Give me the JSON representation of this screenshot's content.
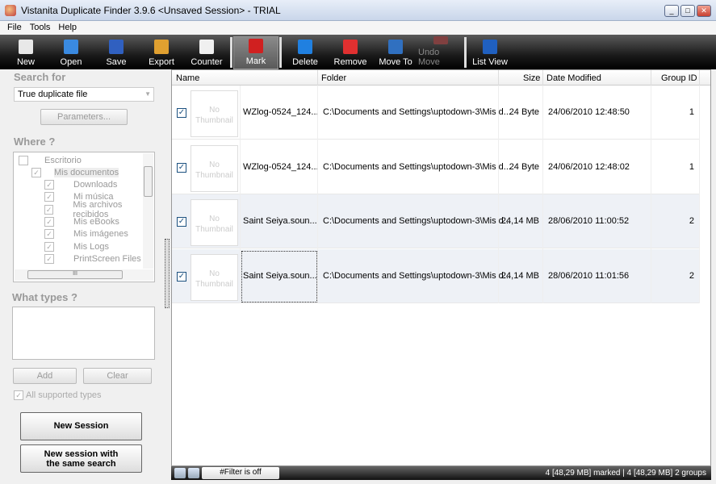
{
  "window": {
    "title": "Vistanita Duplicate Finder 3.9.6 <Unsaved Session> - TRIAL",
    "min": "_",
    "max": "□",
    "close": "✕"
  },
  "menu": [
    "File",
    "Tools",
    "Help"
  ],
  "toolbar": [
    {
      "label": "New",
      "icon": "new-icon",
      "color": "#e8e8e8"
    },
    {
      "label": "Open",
      "icon": "folder-icon",
      "color": "#3a8ae0"
    },
    {
      "label": "Save",
      "icon": "save-icon",
      "color": "#3060c0"
    },
    {
      "label": "Export",
      "icon": "export-icon",
      "color": "#e0a030"
    },
    {
      "label": "Counter",
      "icon": "counter-icon",
      "color": "#f0f0f0"
    },
    {
      "label": "Mark",
      "icon": "checkmark-icon",
      "color": "#d02020"
    },
    {
      "label": "Delete",
      "icon": "delete-icon",
      "color": "#2080e0"
    },
    {
      "label": "Remove",
      "icon": "remove-icon",
      "color": "#e03030"
    },
    {
      "label": "Move To",
      "icon": "move-to-icon",
      "color": "#3070c0"
    },
    {
      "label": "Undo Move",
      "icon": "undo-icon",
      "color": "#804040"
    },
    {
      "label": "List View",
      "icon": "list-view-icon",
      "color": "#2060c0"
    }
  ],
  "left": {
    "search_for": "Search for",
    "search_value": "True duplicate file",
    "parameters": "Parameters...",
    "where": "Where ?",
    "tree": [
      {
        "label": "Escritorio",
        "level": 0
      },
      {
        "label": "Mis documentos",
        "level": 1
      },
      {
        "label": "Downloads",
        "level": 2
      },
      {
        "label": "Mi música",
        "level": 2
      },
      {
        "label": "Mis archivos recibidos",
        "level": 2
      },
      {
        "label": "Mis eBooks",
        "level": 2
      },
      {
        "label": "Mis imágenes",
        "level": 2
      },
      {
        "label": "Mis Logs",
        "level": 2
      },
      {
        "label": "PrintScreen Files",
        "level": 2
      }
    ],
    "what_types": "What types ?",
    "add": "Add",
    "clear": "Clear",
    "all_types": "All supported types",
    "new_session": "New Session",
    "new_session_same_1": "New session with",
    "new_session_same_2": "the same search"
  },
  "grid": {
    "columns": [
      "Name",
      "Folder",
      "Size",
      "Date Modified",
      "Group ID"
    ],
    "thumb_text_1": "No",
    "thumb_text_2": "Thumbnail",
    "rows": [
      {
        "name": "WZlog-0524_124...",
        "folder": "C:\\Documents and Settings\\uptodown-3\\Mis d...",
        "size": "24 Byte",
        "date": "24/06/2010 12:48:50",
        "group": "1",
        "checked": true
      },
      {
        "name": "WZlog-0524_124...",
        "folder": "C:\\Documents and Settings\\uptodown-3\\Mis d...",
        "size": "24 Byte",
        "date": "24/06/2010 12:48:02",
        "group": "1",
        "checked": true
      },
      {
        "name": "Saint Seiya.soun...",
        "folder": "C:\\Documents and Settings\\uptodown-3\\Mis d...",
        "size": "24,14 MB",
        "date": "28/06/2010 11:00:52",
        "group": "2",
        "checked": true
      },
      {
        "name": "Saint Seiya.soun...",
        "folder": "C:\\Documents and Settings\\uptodown-3\\Mis d...",
        "size": "24,14 MB",
        "date": "28/06/2010 11:01:56",
        "group": "2",
        "checked": true
      }
    ]
  },
  "status": {
    "filter": "#Filter is off",
    "info": "4 [48,29 MB] marked  |  4 [48,29 MB] 2 groups"
  }
}
